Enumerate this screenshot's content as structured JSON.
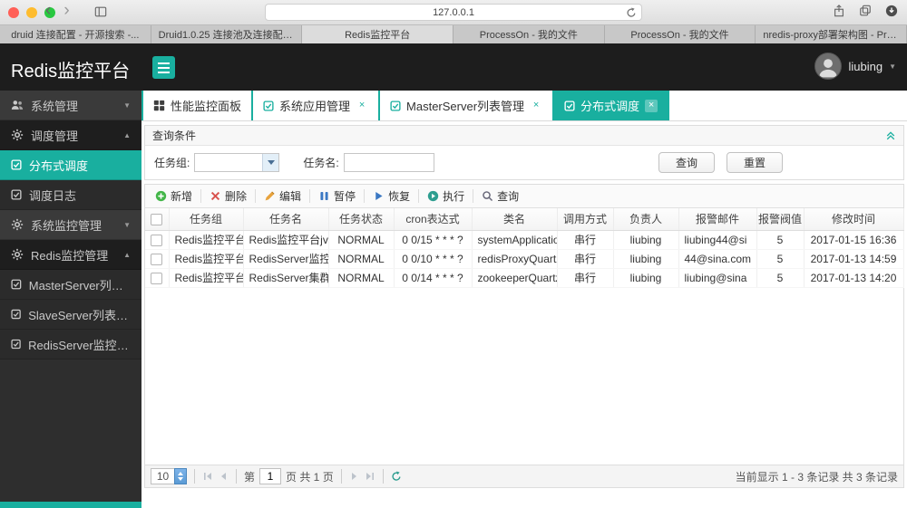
{
  "accent_color": "#19af9f",
  "browser": {
    "url": "127.0.0.1",
    "tabs": [
      "druid 连接配置 - 开源搜索 -...",
      "Druid1.0.25 连接池及连接配置...",
      "Redis监控平台",
      "ProcessOn - 我的文件",
      "ProcessOn - 我的文件",
      "nredis-proxy部署架构图 - Pro..."
    ]
  },
  "header": {
    "title": "Redis监控平台",
    "username": "liubing"
  },
  "sidebar": {
    "items": [
      {
        "label": "系统管理",
        "icon": "users-icon",
        "caret": "down"
      },
      {
        "label": "调度管理",
        "icon": "gear-icon",
        "caret": "up"
      },
      {
        "label": "分布式调度",
        "icon": "check-square-icon",
        "active": true
      },
      {
        "label": "调度日志",
        "icon": "check-square-icon"
      },
      {
        "label": "系统监控管理",
        "icon": "gear-icon",
        "caret": "down"
      },
      {
        "label": "Redis监控管理",
        "icon": "gear-icon",
        "caret": "up"
      },
      {
        "label": "MasterServer列表...",
        "icon": "check-square-icon"
      },
      {
        "label": "SlaveServer列表管...",
        "icon": "check-square-icon"
      },
      {
        "label": "RedisServer监控日...",
        "icon": "check-square-icon"
      }
    ]
  },
  "tabs": {
    "items": [
      {
        "label": "性能监控面板",
        "icon": "dashboard-icon",
        "closable": false
      },
      {
        "label": "系统应用管理",
        "icon": "check-square-icon",
        "closable": true
      },
      {
        "label": "MasterServer列表管理",
        "icon": "check-square-icon",
        "closable": true
      },
      {
        "label": "分布式调度",
        "icon": "check-square-icon",
        "closable": true,
        "active": true
      }
    ]
  },
  "query": {
    "title": "查询条件",
    "task_group_label": "任务组:",
    "task_name_label": "任务名:",
    "task_group_value": "",
    "task_name_value": "",
    "search_button": "查询",
    "reset_button": "重置"
  },
  "toolbar": {
    "buttons": [
      {
        "label": "新增",
        "icon": "plus-icon"
      },
      {
        "label": "删除",
        "icon": "delete-icon"
      },
      {
        "label": "编辑",
        "icon": "edit-icon"
      },
      {
        "label": "暂停",
        "icon": "pause-icon"
      },
      {
        "label": "恢复",
        "icon": "resume-icon"
      },
      {
        "label": "执行",
        "icon": "run-icon"
      },
      {
        "label": "查询",
        "icon": "search-icon"
      }
    ]
  },
  "table": {
    "columns": [
      "任务组",
      "任务名",
      "任务状态",
      "cron表达式",
      "类名",
      "调用方式",
      "负责人",
      "报警邮件",
      "报警阀值",
      "修改时间"
    ],
    "rows": [
      [
        "Redis监控平台",
        "Redis监控平台jvm",
        "NORMAL",
        "0 0/15 * * * ?",
        "systemApplicatio",
        "串行",
        "liubing",
        "liubing44@si",
        "5",
        "2017-01-15 16:36"
      ],
      [
        "Redis监控平台",
        "RedisServer监控",
        "NORMAL",
        "0 0/10 * * * ?",
        "redisProxyQuartz",
        "串行",
        "liubing",
        "44@sina.com",
        "5",
        "2017-01-13 14:59"
      ],
      [
        "Redis监控平台",
        "RedisServer集群",
        "NORMAL",
        "0 0/14 * * * ?",
        "zookeeperQuartz",
        "串行",
        "liubing",
        "liubing@sina",
        "5",
        "2017-01-13 14:20"
      ]
    ]
  },
  "pagination": {
    "page_size": "10",
    "label_page": "第",
    "page_value": "1",
    "label_total": "页 共 1 页",
    "summary": "当前显示 1 - 3 条记录 共 3 条记录"
  }
}
